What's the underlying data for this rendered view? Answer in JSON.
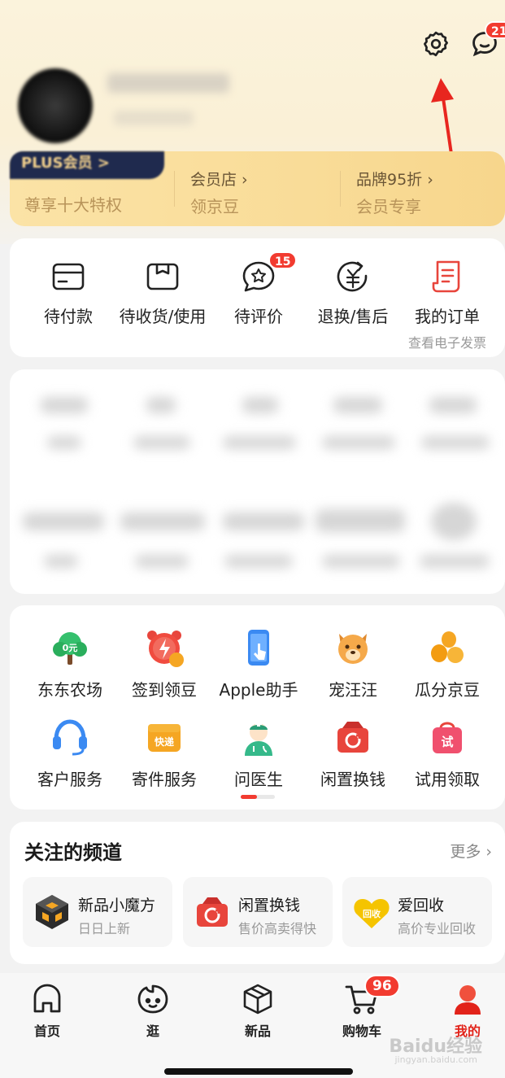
{
  "header": {
    "message_badge": "21"
  },
  "member": {
    "plus_label": "PLUS会员 >",
    "plus_sub": "尊享十大特权",
    "store_title": "会员店 ›",
    "store_sub": "领京豆",
    "brand_title": "品牌95折 ›",
    "brand_sub": "会员专享"
  },
  "orders": {
    "items": [
      {
        "label": "待付款",
        "icon": "wallet-icon"
      },
      {
        "label": "待收货/使用",
        "icon": "package-icon"
      },
      {
        "label": "待评价",
        "icon": "review-icon",
        "badge": "15"
      },
      {
        "label": "退换/售后",
        "icon": "refund-icon"
      },
      {
        "label": "我的订单",
        "icon": "order-list-icon",
        "sub": "查看电子发票"
      }
    ]
  },
  "services": {
    "items": [
      {
        "label": "东东农场",
        "icon": "tree-icon",
        "icon_text": "0元"
      },
      {
        "label": "签到领豆",
        "icon": "alarm-clock-icon"
      },
      {
        "label": "Apple助手",
        "icon": "phone-icon"
      },
      {
        "label": "宠汪汪",
        "icon": "dog-icon"
      },
      {
        "label": "瓜分京豆",
        "icon": "beans-icon"
      },
      {
        "label": "客户服务",
        "icon": "headset-icon"
      },
      {
        "label": "寄件服务",
        "icon": "express-icon",
        "icon_text": "快递"
      },
      {
        "label": "问医生",
        "icon": "doctor-icon"
      },
      {
        "label": "闲置换钱",
        "icon": "recycle-box-icon"
      },
      {
        "label": "试用领取",
        "icon": "trial-bag-icon",
        "icon_text": "试"
      }
    ]
  },
  "channels": {
    "title": "关注的频道",
    "more": "更多 ›",
    "items": [
      {
        "title": "新品小魔方",
        "sub": "日日上新",
        "icon": "cube-icon"
      },
      {
        "title": "闲置换钱",
        "sub": "售价高卖得快",
        "icon": "recycle-box-icon"
      },
      {
        "title": "爱回收",
        "sub": "高价专业回收",
        "icon": "recycle-heart-icon",
        "icon_text": "回收"
      }
    ]
  },
  "tabbar": {
    "items": [
      {
        "label": "首页",
        "icon": "home-icon"
      },
      {
        "label": "逛",
        "icon": "browse-face-icon"
      },
      {
        "label": "新品",
        "icon": "box-icon"
      },
      {
        "label": "购物车",
        "icon": "cart-icon",
        "badge": "96"
      },
      {
        "label": "我的",
        "icon": "profile-icon",
        "active": true
      }
    ]
  },
  "watermark": {
    "text": "Baidu经验",
    "sub": "jingyan.baidu.com"
  },
  "colors": {
    "accent": "#e2231a",
    "badge": "#f23b30",
    "member_gold": "#f9dc98",
    "plus_navy": "#1f2a4e"
  }
}
